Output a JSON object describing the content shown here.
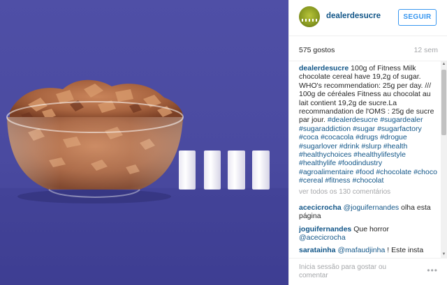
{
  "post": {
    "username": "dealerdesucre",
    "follow_label": "SEGUIR",
    "likes": "575 gostos",
    "time": "12 sem"
  },
  "caption": {
    "user": "dealerdesucre",
    "text": "100g of Fitness Milk chocolate cereal have 19,2g of sugar. WHO's recommendation: 25g per day. /// 100g de céréales Fitness au chocolat au lait contient 19,2g de sucre.La recommandation de l'OMS : 25g de sucre par jour.",
    "tags": [
      "#dealerdesucre",
      "#sugardealer",
      "#sugaraddiction",
      "#sugar",
      "#sugarfactory",
      "#coca",
      "#cocacola",
      "#drugs",
      "#drogue",
      "#sugarlover",
      "#drink",
      "#slurp",
      "#health",
      "#healthychoices",
      "#healthylifestyle",
      "#healthylife",
      "#foodindustry",
      "#agroalimentaire",
      "#food",
      "#chocolate",
      "#choco",
      "#cereal",
      "#fitness",
      "#chocolat"
    ]
  },
  "load_more": "ver todos os 130 comentários",
  "comments": [
    {
      "user": "acecicrocha",
      "mention": "@joguifernandes",
      "text": "olha esta página"
    },
    {
      "user": "joguifernandes",
      "mention": "",
      "text": "Que horror",
      "mention_after": "@acecicrocha"
    },
    {
      "user": "saratainha",
      "mention": "@mafaudjinha",
      "text": "! Este insta"
    }
  ],
  "footer": {
    "login_text": "Inicia sessão para gostar ou comentar",
    "more_icon": "more-horizontal-icon"
  },
  "photo": {
    "background_color": "#4a4aa0",
    "sugar_cube_count": 4
  }
}
